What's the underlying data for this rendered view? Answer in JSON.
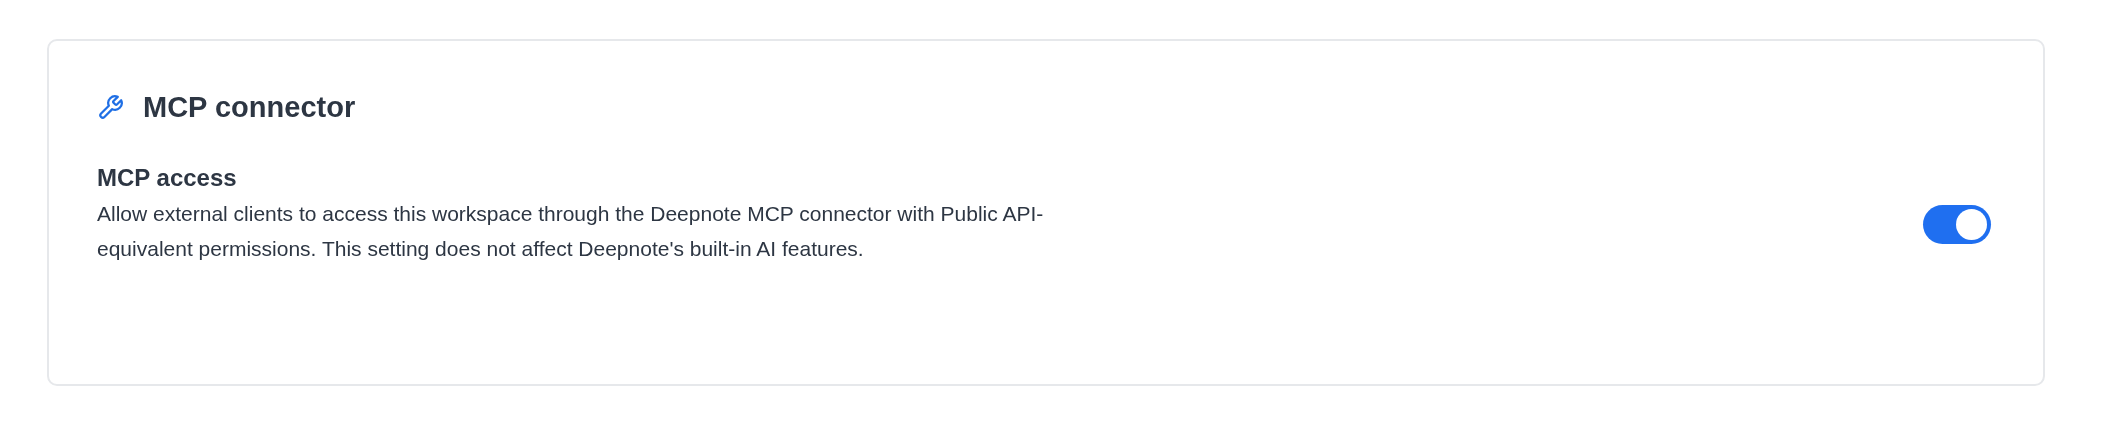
{
  "section": {
    "title": "MCP connector"
  },
  "setting": {
    "label": "MCP access",
    "description": "Allow external clients to access this workspace through the Deepnote MCP connector with Public API-equivalent permissions. This setting does not affect Deepnote's built-in AI features.",
    "on": true
  }
}
